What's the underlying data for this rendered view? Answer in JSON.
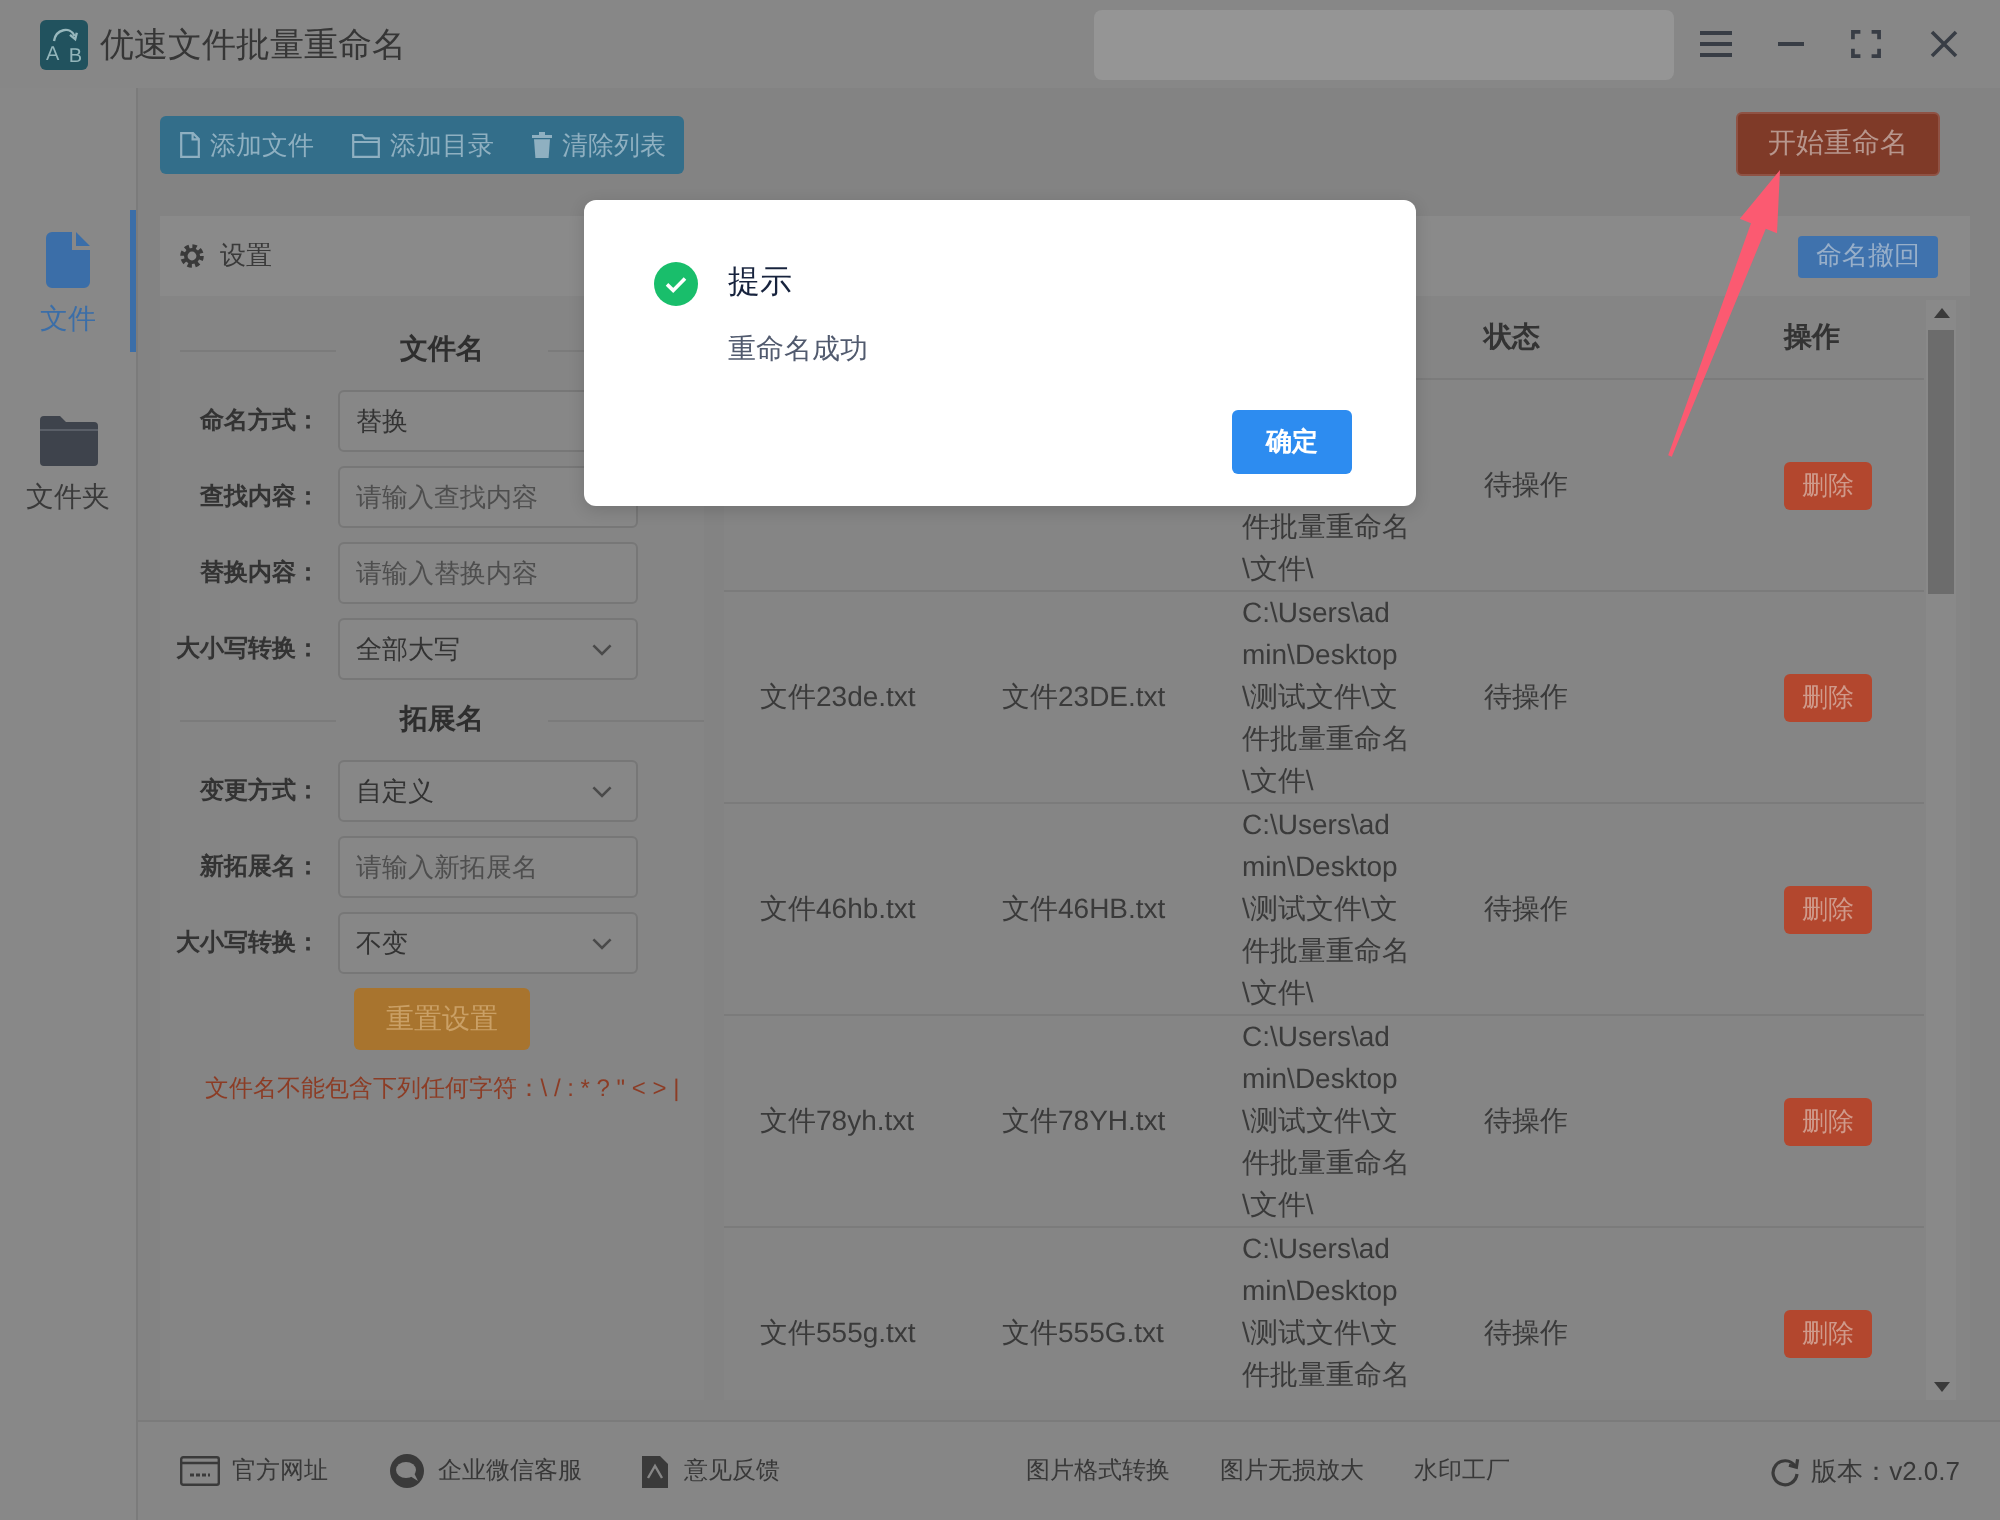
{
  "window": {
    "logo": {
      "left": "A",
      "right": "B"
    },
    "title": "优速文件批量重命名"
  },
  "toolbar": {
    "buttons": [
      {
        "label": "添加文件",
        "kind": "file"
      },
      {
        "label": "添加目录",
        "kind": "folder"
      },
      {
        "label": "清除列表",
        "kind": "trash"
      }
    ],
    "start_button": "开始重命名"
  },
  "sidebar": {
    "items": [
      {
        "label": "文件",
        "kind": "file",
        "selected": true
      },
      {
        "label": "文件夹",
        "kind": "folder",
        "selected": false
      }
    ]
  },
  "settings": {
    "title": "设置",
    "sections": [
      {
        "title": "文件名",
        "fields": [
          {
            "label": "命名方式：",
            "kind": "input",
            "value": "替换"
          },
          {
            "label": "查找内容：",
            "kind": "input",
            "placeholder": "请输入查找内容"
          },
          {
            "label": "替换内容：",
            "kind": "input",
            "placeholder": "请输入替换内容"
          },
          {
            "label": "大小写转换：",
            "kind": "select",
            "value": "全部大写"
          }
        ]
      },
      {
        "title": "拓展名",
        "fields": [
          {
            "label": "变更方式：",
            "kind": "select",
            "value": "自定义"
          },
          {
            "label": "新拓展名：",
            "kind": "input",
            "placeholder": "请输入新拓展名"
          },
          {
            "label": "大小写转换：",
            "kind": "select",
            "value": "不变"
          }
        ]
      }
    ],
    "reset_button": "重置设置",
    "note": "文件名不能包含下列任何字符：\\ / : * ? \" < > |"
  },
  "table": {
    "undo_button": "命名撤回",
    "columns": {
      "status": "状态",
      "action": "操作"
    },
    "rows": [
      {
        "path": "件批量重命名\\文件\\",
        "status": "待操作",
        "action": "删除"
      },
      {
        "name": "文件23de.txt",
        "new_name": "文件23DE.txt",
        "path": "C:\\Users\\admin\\Desktop\\测试文件\\文件批量重命名\\文件\\",
        "status": "待操作",
        "action": "删除"
      },
      {
        "name": "文件46hb.txt",
        "new_name": "文件46HB.txt",
        "path": "C:\\Users\\admin\\Desktop\\测试文件\\文件批量重命名\\文件\\",
        "status": "待操作",
        "action": "删除"
      },
      {
        "name": "文件78yh.txt",
        "new_name": "文件78YH.txt",
        "path": "C:\\Users\\admin\\Desktop\\测试文件\\文件批量重命名\\文件\\",
        "status": "待操作",
        "action": "删除"
      },
      {
        "name": "文件555g.txt",
        "new_name": "文件555G.txt",
        "path": "C:\\Users\\admin\\Desktop\\测试文件\\文件批量重命名",
        "status": "待操作",
        "action": "删除"
      }
    ]
  },
  "footer": {
    "links": [
      {
        "label": "官方网址",
        "kind": "website"
      },
      {
        "label": "企业微信客服",
        "kind": "chat"
      },
      {
        "label": "意见反馈",
        "kind": "feedback"
      }
    ],
    "tools": [
      "图片格式转换",
      "图片无损放大",
      "水印工厂"
    ],
    "version": "版本：v2.0.7"
  },
  "dialog": {
    "title": "提示",
    "message": "重命名成功",
    "confirm_button": "确定"
  }
}
